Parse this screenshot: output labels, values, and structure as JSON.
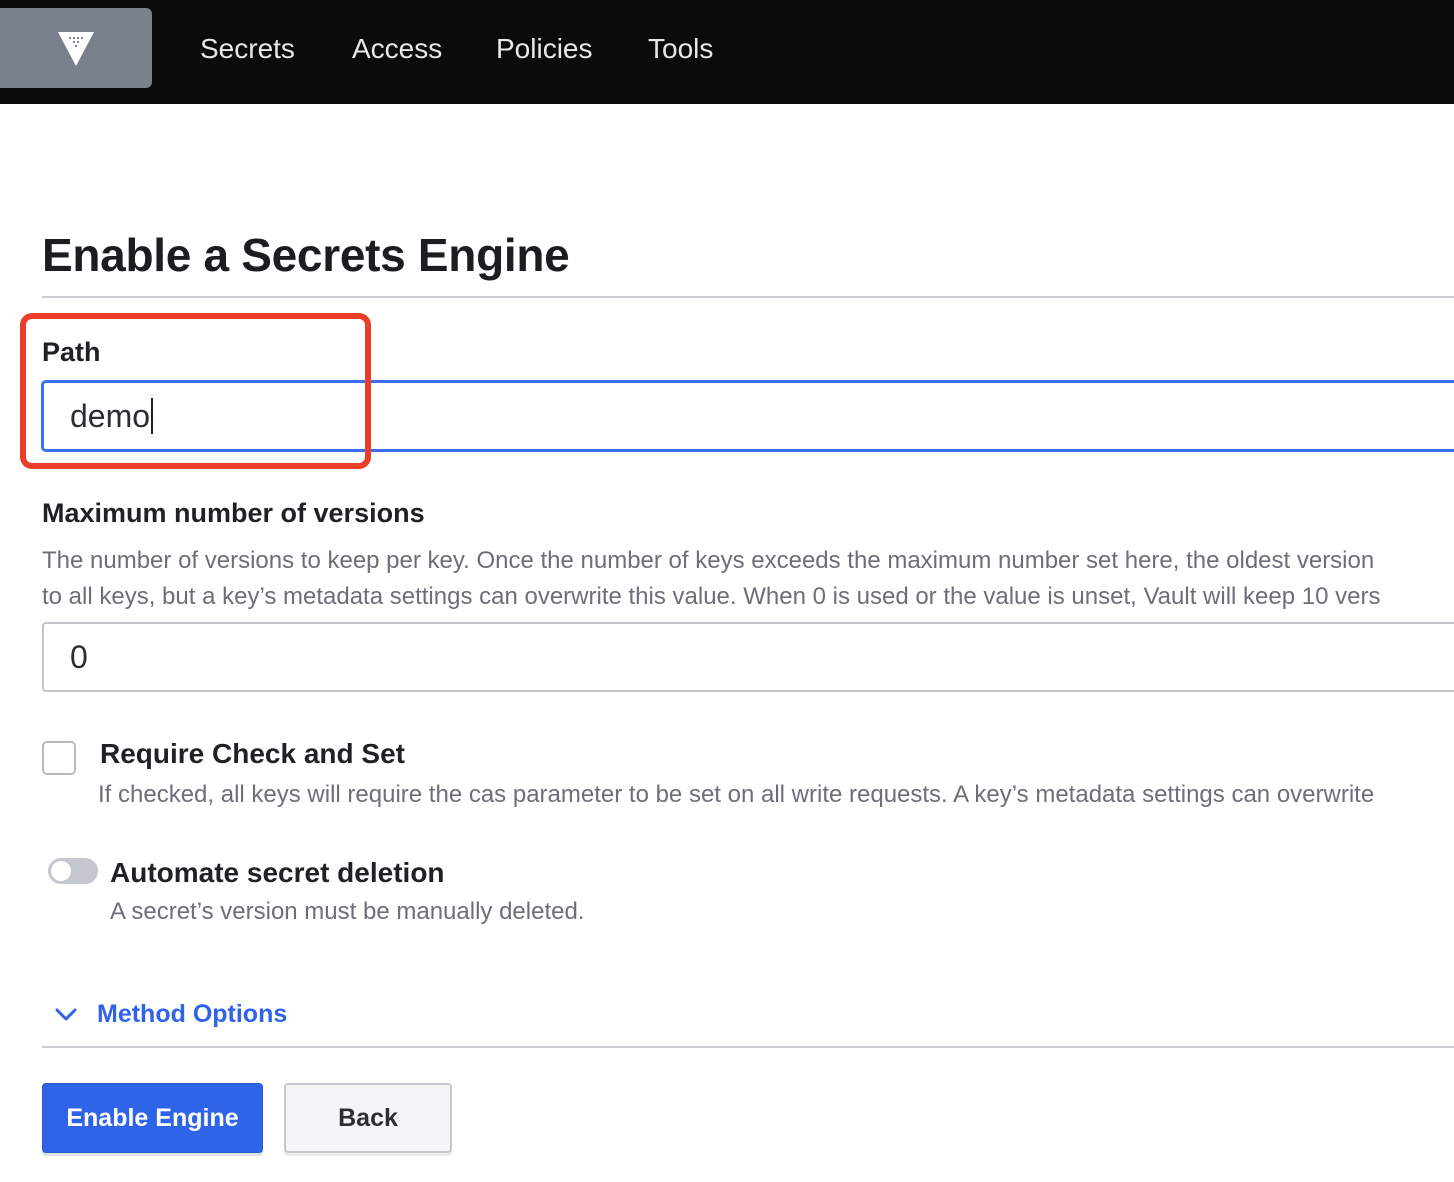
{
  "nav": {
    "logo_icon": "vault-logo-icon",
    "items": [
      "Secrets",
      "Access",
      "Policies",
      "Tools"
    ]
  },
  "page": {
    "title": "Enable a Secrets Engine"
  },
  "path_field": {
    "label": "Path",
    "value": "demo"
  },
  "max_versions": {
    "label": "Maximum number of versions",
    "help_line1": "The number of versions to keep per key. Once the number of keys exceeds the maximum number set here, the oldest version",
    "help_line2": "to all keys, but a key’s metadata settings can overwrite this value. When 0 is used or the value is unset, Vault will keep 10 vers",
    "value": "0"
  },
  "cas": {
    "label": "Require Check and Set",
    "help": "If checked, all keys will require the cas parameter to be set on all write requests. A key’s metadata settings can overwrite",
    "checked": false
  },
  "auto_delete": {
    "label": "Automate secret deletion",
    "help": "A secret’s version must be manually deleted.",
    "enabled": false
  },
  "method_options": {
    "label": "Method Options",
    "icon": "chevron-down-icon"
  },
  "actions": {
    "primary": "Enable Engine",
    "secondary": "Back"
  },
  "colors": {
    "nav_bg": "#0b0b0c",
    "accent": "#2f63e8",
    "highlight": "#ea3e2a",
    "focus": "#3a6ff0"
  }
}
